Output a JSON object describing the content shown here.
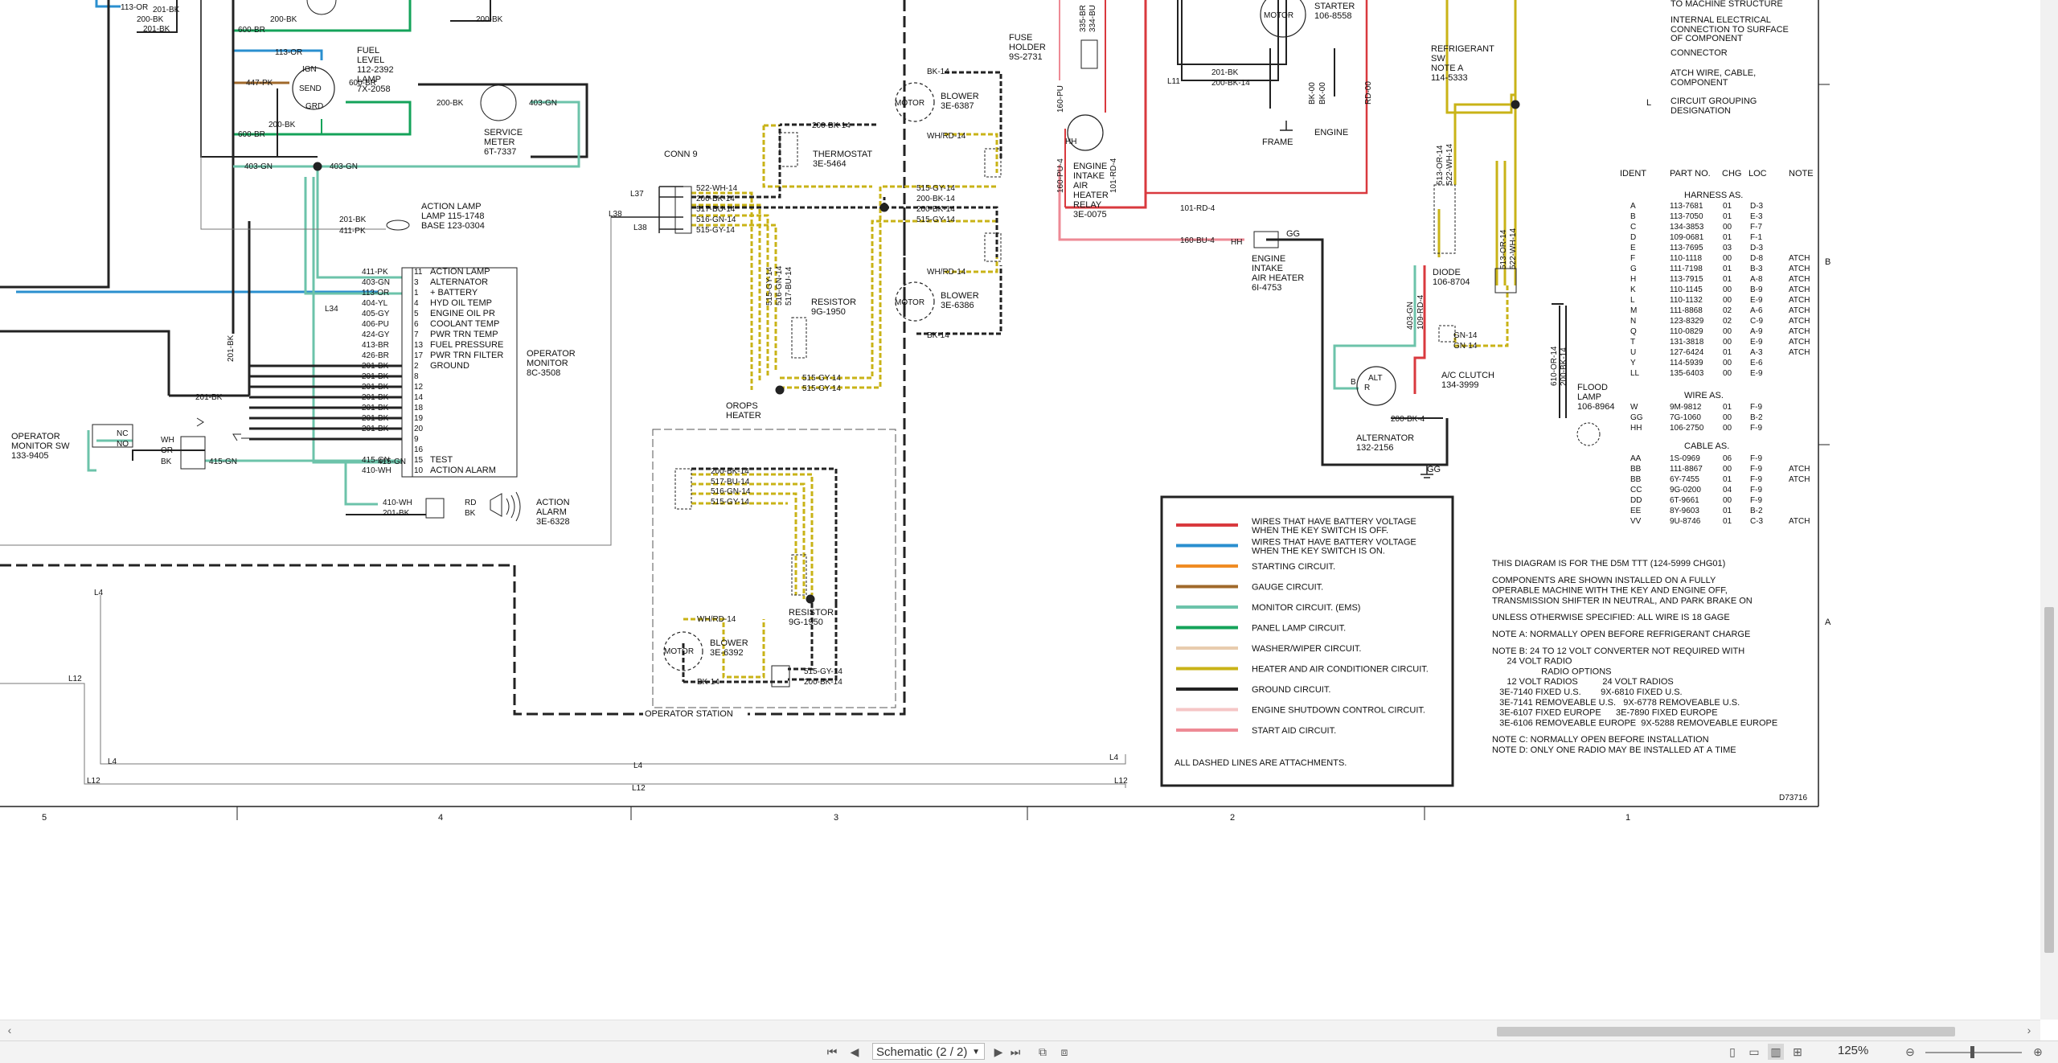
{
  "legend": [
    {
      "label": "WIRES THAT HAVE BATTERY VOLTAGE",
      "label2": "WHEN THE KEY SWITCH IS OFF.",
      "color": "#d9393e"
    },
    {
      "label": "WIRES THAT HAVE BATTERY VOLTAGE",
      "label2": "WHEN THE KEY SWITCH IS ON.",
      "color": "#2a8fcf"
    },
    {
      "label": "STARTING CIRCUIT.",
      "label2": "",
      "color": "#f08c24"
    },
    {
      "label": "GAUGE CIRCUIT.",
      "label2": "",
      "color": "#a0692b"
    },
    {
      "label": "MONITOR CIRCUIT. (EMS)",
      "label2": "",
      "color": "#6cc3aa"
    },
    {
      "label": "PANEL LAMP CIRCUIT.",
      "label2": "",
      "color": "#14a35a"
    },
    {
      "label": "WASHER/WIPER CIRCUIT.",
      "label2": "",
      "color": "#e8ccae"
    },
    {
      "label": "HEATER AND AIR CONDITIONER CIRCUIT.",
      "label2": "",
      "color": "#c9b317"
    },
    {
      "label": "GROUND CIRCUIT.",
      "label2": "",
      "color": "#222222"
    },
    {
      "label": "ENGINE SHUTDOWN CONTROL CIRCUIT.",
      "label2": "",
      "color": "#f5c6c6"
    },
    {
      "label": "START AID CIRCUIT.",
      "label2": "",
      "color": "#ee8a95"
    }
  ],
  "legend_footer": "ALL DASHED LINES ARE ATTACHMENTS.",
  "symbols_key": [
    "TO MACHINE STRUCTURE",
    "INTERNAL ELECTRICAL",
    "CONNECTION TO SURFACE",
    "OF COMPONENT",
    "CONNECTOR",
    "ATCH WIRE, CABLE,",
    "COMPONENT",
    "CIRCUIT GROUPING",
    "DESIGNATION"
  ],
  "parts_table": {
    "headers": [
      "IDENT",
      "PART NO.",
      "CHG",
      "LOC",
      "NOTE"
    ],
    "harness_title": "HARNESS AS.",
    "harness": [
      [
        "A",
        "113-7681",
        "01",
        "D-3",
        ""
      ],
      [
        "B",
        "113-7050",
        "01",
        "E-3",
        ""
      ],
      [
        "C",
        "134-3853",
        "00",
        "F-7",
        ""
      ],
      [
        "D",
        "109-0681",
        "01",
        "F-1",
        ""
      ],
      [
        "E",
        "113-7695",
        "03",
        "D-3",
        ""
      ],
      [
        "F",
        "110-1118",
        "00",
        "D-8",
        "ATCH"
      ],
      [
        "G",
        "111-7198",
        "01",
        "B-3",
        "ATCH"
      ],
      [
        "H",
        "113-7915",
        "01",
        "A-8",
        "ATCH"
      ],
      [
        "K",
        "110-1145",
        "00",
        "B-9",
        "ATCH"
      ],
      [
        "L",
        "110-1132",
        "00",
        "E-9",
        "ATCH"
      ],
      [
        "M",
        "111-8868",
        "02",
        "A-6",
        "ATCH"
      ],
      [
        "N",
        "123-8329",
        "02",
        "C-9",
        "ATCH"
      ],
      [
        "Q",
        "110-0829",
        "00",
        "A-9",
        "ATCH"
      ],
      [
        "T",
        "131-3818",
        "00",
        "E-9",
        "ATCH"
      ],
      [
        "U",
        "127-6424",
        "01",
        "A-3",
        "ATCH"
      ],
      [
        "Y",
        "114-5939",
        "00",
        "E-6",
        ""
      ],
      [
        "LL",
        "135-6403",
        "00",
        "E-9",
        ""
      ]
    ],
    "wire_title": "WIRE AS.",
    "wire": [
      [
        "W",
        "9M-9812",
        "01",
        "F-9",
        ""
      ],
      [
        "GG",
        "7G-1060",
        "00",
        "B-2",
        ""
      ],
      [
        "HH",
        "106-2750",
        "00",
        "F-9",
        ""
      ]
    ],
    "cable_title": "CABLE AS.",
    "cable": [
      [
        "AA",
        "1S-0969",
        "06",
        "F-9",
        ""
      ],
      [
        "BB",
        "111-8867",
        "00",
        "F-9",
        "ATCH"
      ],
      [
        "BB",
        "6Y-7455",
        "01",
        "F-9",
        "ATCH"
      ],
      [
        "CC",
        "9G-0200",
        "04",
        "F-9",
        ""
      ],
      [
        "DD",
        "6T-9661",
        "00",
        "F-9",
        ""
      ],
      [
        "EE",
        "8Y-9603",
        "01",
        "B-2",
        ""
      ],
      [
        "VV",
        "9U-8746",
        "01",
        "C-3",
        "ATCH"
      ]
    ]
  },
  "notes": [
    "THIS DIAGRAM IS FOR THE D5M TTT (124-5999 CHG01)",
    "",
    "COMPONENTS ARE SHOWN INSTALLED ON A FULLY",
    "OPERABLE MACHINE WITH THE KEY AND ENGINE OFF,",
    "TRANSMISSION SHIFTER IN NEUTRAL, AND PARK BRAKE ON",
    "",
    "UNLESS OTHERWISE SPECIFIED: ALL WIRE IS 18 GAGE",
    "",
    "NOTE A: NORMALLY OPEN BEFORE REFRIGERANT CHARGE",
    "",
    "NOTE B: 24 TO 12 VOLT CONVERTER NOT REQUIRED WITH",
    "      24 VOLT RADIO",
    "                    RADIO OPTIONS",
    "      12 VOLT RADIOS          24 VOLT RADIOS",
    "   3E-7140 FIXED U.S.        9X-6810 FIXED U.S.",
    "   3E-7141 REMOVEABLE U.S.   9X-6778 REMOVEABLE U.S.",
    "   3E-6107 FIXED EUROPE      3E-7890 FIXED EUROPE",
    "   3E-6106 REMOVEABLE EUROPE  9X-5288 REMOVEABLE EUROPE",
    "",
    "NOTE C: NORMALLY OPEN BEFORE INSTALLATION",
    "NOTE D: ONLY ONE RADIO MAY BE INSTALLED AT A TIME"
  ],
  "drawing_number": "D73716",
  "zone_columns": [
    "5",
    "4",
    "3",
    "2",
    "1"
  ],
  "zone_rows": [
    "B",
    "A"
  ],
  "monitor_pins": [
    {
      "wire": "411-PK",
      "pin": "11",
      "label": "ACTION LAMP"
    },
    {
      "wire": "403-GN",
      "pin": "3",
      "label": "ALTERNATOR"
    },
    {
      "wire": "113-OR",
      "pin": "1",
      "label": "+ BATTERY"
    },
    {
      "wire": "404-YL",
      "pin": "4",
      "label": "HYD OIL TEMP"
    },
    {
      "wire": "405-GY",
      "pin": "5",
      "label": "ENGINE OIL PR"
    },
    {
      "wire": "406-PU",
      "pin": "6",
      "label": "COOLANT TEMP"
    },
    {
      "wire": "424-GY",
      "pin": "7",
      "label": "PWR TRN TEMP"
    },
    {
      "wire": "413-BR",
      "pin": "13",
      "label": "FUEL PRESSURE"
    },
    {
      "wire": "426-BR",
      "pin": "17",
      "label": "PWR TRN FILTER"
    },
    {
      "wire": "201-BK",
      "pin": "2",
      "label": "GROUND"
    },
    {
      "wire": "201-BK",
      "pin": "8",
      "label": ""
    },
    {
      "wire": "201-BK",
      "pin": "12",
      "label": ""
    },
    {
      "wire": "201-BK",
      "pin": "14",
      "label": ""
    },
    {
      "wire": "201-BK",
      "pin": "18",
      "label": ""
    },
    {
      "wire": "201-BK",
      "pin": "19",
      "label": ""
    },
    {
      "wire": "201-BK",
      "pin": "20",
      "label": ""
    },
    {
      "wire": "",
      "pin": "9",
      "label": ""
    },
    {
      "wire": "",
      "pin": "16",
      "label": ""
    },
    {
      "wire": "415-GN",
      "pin": "15",
      "label": "TEST"
    },
    {
      "wire": "410-WH",
      "pin": "10",
      "label": "ACTION ALARM"
    }
  ],
  "components": {
    "operator_monitor": [
      "OPERATOR",
      "MONITOR",
      "8C-3508"
    ],
    "operator_monitor_sw": [
      "OPERATOR",
      "MONITOR SW",
      "133-9405"
    ],
    "action_lamp": [
      "ACTION LAMP",
      "LAMP 115-1748",
      "BASE 123-0304"
    ],
    "action_alarm": [
      "ACTION",
      "ALARM",
      "3E-6328"
    ],
    "fuel_level": [
      "FUEL",
      "LEVEL",
      "112-2392",
      "LAMP",
      "7X-2058"
    ],
    "service_meter": [
      "SERVICE",
      "METER",
      "6T-7337"
    ],
    "conn9": "CONN 9",
    "thermostat": [
      "THERMOSTAT",
      "3E-5464"
    ],
    "resistor1": [
      "RESISTOR",
      "9G-1950"
    ],
    "resistor2": [
      "RESISTOR",
      "9G-1950"
    ],
    "blower1": [
      "BLOWER",
      "3E-6387"
    ],
    "blower2": [
      "BLOWER",
      "3E-6386"
    ],
    "blower3": [
      "BLOWER",
      "3E-6392"
    ],
    "orops_heater": [
      "OROPS",
      "HEATER"
    ],
    "operator_station": "OPERATOR STATION",
    "fuse_holder": [
      "FUSE",
      "HOLDER",
      "9S-2731"
    ],
    "intake_relay": [
      "ENGINE",
      "INTAKE",
      "AIR",
      "HEATER",
      "RELAY",
      "3E-0075"
    ],
    "intake_heater": [
      "ENGINE",
      "INTAKE",
      "AIR HEATER",
      "6I-4753"
    ],
    "starter": [
      "STARTER",
      "106-8558"
    ],
    "frame": "FRAME",
    "engine": "ENGINE",
    "alternator": [
      "ALTERNATOR",
      "132-2156"
    ],
    "refrigerant_sw": [
      "REFRIGERANT",
      "SW",
      "NOTE A",
      "114-5333"
    ],
    "diode": [
      "DIODE",
      "106-8704"
    ],
    "ac_clutch": [
      "A/C CLUTCH",
      "134-3999"
    ],
    "flood_lamp": [
      "FLOOD",
      "LAMP",
      "106-8964"
    ]
  },
  "wire_labels": {
    "w113or_top": "113-OR",
    "w200bk_a": "200-BK",
    "w201bk_a": "201-BK",
    "w113or_b": "113-OR",
    "w447pk": "447-PK",
    "w600br_a": "600-BR",
    "w600br_b": "600-BR",
    "w600br_c": "600-BR",
    "w200bk_b": "200-BK",
    "w200bk_c": "200-BK",
    "w403gn_a": "403-GN",
    "w403gn_b": "403-GN",
    "w200bk_d": "200-BK",
    "w403gn_c": "403-GN",
    "w201bk_b": "201-BK",
    "w411pk": "411-PK",
    "w201bk_c": "201-BK",
    "w415gn": "415-GN",
    "w410wh": "410-WH",
    "w201bk_d": "201-BK",
    "w200bk14_a": "200-BK-14",
    "wbk14_a": "BK-14",
    "wwhrd14_a": "WH/RD-14",
    "w522wh": "522-WH-14",
    "w200bk14_b": "200-BK-14",
    "w517bu": "517-BU-14",
    "w516gn": "516-GN-14",
    "w515gy": "515-GY-14",
    "w515gy_b": "515-GY-14",
    "w200bk14_c": "200-BK-14",
    "w515gy_c": "515-GY-14",
    "wwhrd14_b": "WH/RD-14",
    "wbk14_b": "BK-14",
    "w515gy_d": "515-GY-14",
    "w515gy_e": "515-GY-14",
    "w200bk14_d": "200-BK-14",
    "w517bu_b": "517-BU-14",
    "w516gn_b": "516-GN-14",
    "w515gy_f": "515-GY-14",
    "wwhrd14_c": "WH/RD-14",
    "wbk14_c": "BK-14",
    "w515gy_g": "515-GY-14",
    "w200bk14_e": "200-BK-14",
    "w101rd": "101-RD-4",
    "w160bu": "160-BU-4",
    "w160pu": "160-PU-4",
    "w160pu_b": "160-PU",
    "w201bk_s": "201-BK",
    "w200bk14_s": "200-BK-14",
    "wbk00": "BK-00",
    "wbk00b": "BK-00",
    "wrd00": "RD-00",
    "w403gn_alt": "403-GN",
    "w109rd": "109-RD-4",
    "w200bk4": "200-BK-4",
    "w513or": "513-OR-14",
    "w522wh_b": "522-WH-14",
    "w513or_b": "513-OR-14",
    "w522wh_c": "522-WH-14",
    "wgn14_a": "GN-14",
    "wgn14_b": "GN-14",
    "w610or": "610-OR-14",
    "w200bk14_f": "200-BK-14",
    "w335br": "335-BR",
    "w334bu": "334-BU",
    "w201bk_e": "201-BK"
  },
  "circuit_labels": {
    "L4": "L4",
    "L12": "L12",
    "L34": "L34",
    "L37": "L37",
    "L38": "L38",
    "L11": "L11"
  },
  "pin_letters": {
    "E": "E",
    "IGN": "IGN",
    "SEND": "SEND",
    "GRD": "GRD",
    "MOTOR": "MOTOR",
    "ALT": "ALT",
    "R": "R",
    "B": "B",
    "HH": "HH",
    "GG": "GG",
    "WH": "WH",
    "OR": "OR",
    "BK": "BK",
    "RD": "RD",
    "NC": "NC",
    "NO": "NO",
    "C": "C",
    "A": "A",
    "G": "G",
    "U": "U",
    "D": "D"
  },
  "viewer": {
    "page_selector": "Schematic (2 / 2)",
    "zoom": "125%"
  }
}
